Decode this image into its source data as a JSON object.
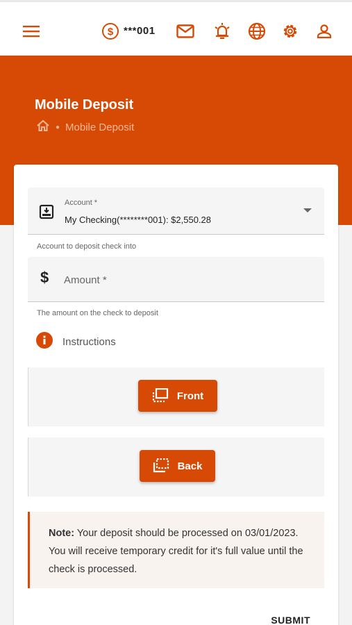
{
  "topbar": {
    "account_masked": "***001",
    "icons": [
      "menu-icon",
      "dollar-circle-icon",
      "mail-icon",
      "alarm-bell-icon",
      "globe-icon",
      "gear-icon",
      "user-icon"
    ]
  },
  "header": {
    "title": "Mobile Deposit",
    "breadcrumb_current": "Mobile Deposit"
  },
  "form": {
    "account_label": "Account *",
    "account_value": "My Checking(********001): $2,550.28",
    "account_helper": "Account to deposit check into",
    "amount_placeholder": "Amount *",
    "amount_helper": "The amount on the check to deposit",
    "instructions_label": "Instructions",
    "front_label": "Front",
    "back_label": "Back",
    "note_bold": "Note:",
    "note_text": " Your deposit should be processed on 03/01/2023. You will receive temporary credit for it's full value until the check is processed.",
    "submit_label": "SUBMIT"
  },
  "colors": {
    "accent": "#d64a05",
    "banner": "#d64a05"
  }
}
